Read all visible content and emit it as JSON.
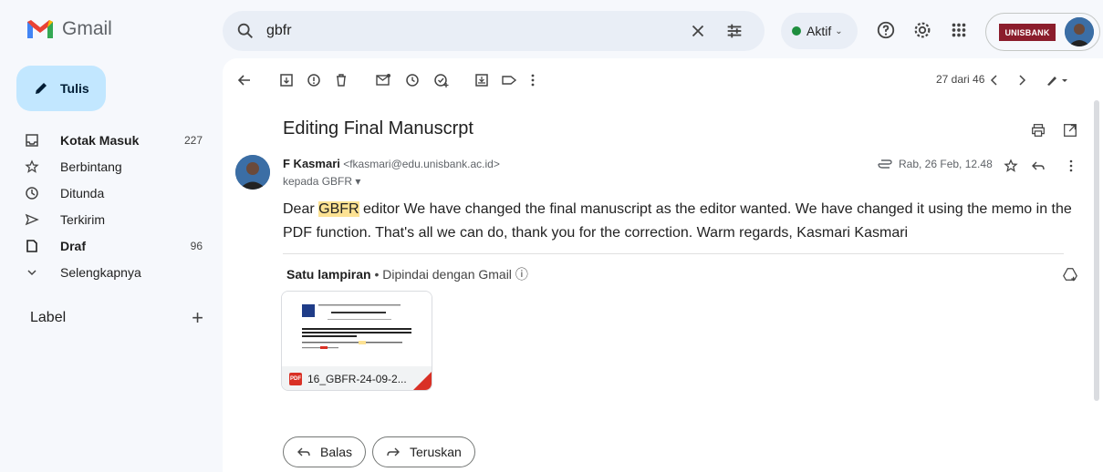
{
  "app": {
    "name": "Gmail"
  },
  "search": {
    "value": "gbfr"
  },
  "status": {
    "label": "Aktif"
  },
  "account": {
    "org_badge": "UNISBANK"
  },
  "sidebar": {
    "compose_label": "Tulis",
    "items": [
      {
        "label": "Kotak Masuk",
        "count": "227",
        "bold": true,
        "icon": "inbox-icon"
      },
      {
        "label": "Berbintang",
        "count": "",
        "bold": false,
        "icon": "star-icon"
      },
      {
        "label": "Ditunda",
        "count": "",
        "bold": false,
        "icon": "clock-icon"
      },
      {
        "label": "Terkirim",
        "count": "",
        "bold": false,
        "icon": "send-icon"
      },
      {
        "label": "Draf",
        "count": "96",
        "bold": true,
        "icon": "draft-icon"
      },
      {
        "label": "Selengkapnya",
        "count": "",
        "bold": false,
        "icon": "chevron-down-icon"
      }
    ],
    "labels_heading": "Label"
  },
  "toolbar": {
    "pager": "27 dari 46"
  },
  "email": {
    "subject": "Editing Final Manuscrpt",
    "sender_name": "F Kasmari",
    "sender_email": "<fkasmari@edu.unisbank.ac.id>",
    "to": "kepada GBFR",
    "date": "Rab, 26 Feb, 12.48",
    "body_before": "Dear ",
    "body_highlight": "GBFR",
    "body_after": " editor We have changed the final manuscript as the editor wanted. We have changed it using the memo in the PDF function. That's all we can do, thank you for the correction. Warm regards, Kasmari Kasmari"
  },
  "attachment": {
    "heading": "Satu lampiran",
    "scan_note": "Dipindai dengan Gmail",
    "filename": "16_GBFR-24-09-2...",
    "badge": "PDF"
  },
  "actions": {
    "reply": "Balas",
    "forward": "Teruskan"
  },
  "colors": {
    "compose_bg": "#c2e7ff",
    "status_green": "#1e8e3e",
    "highlight": "#fde293",
    "pdf_red": "#d93025"
  }
}
